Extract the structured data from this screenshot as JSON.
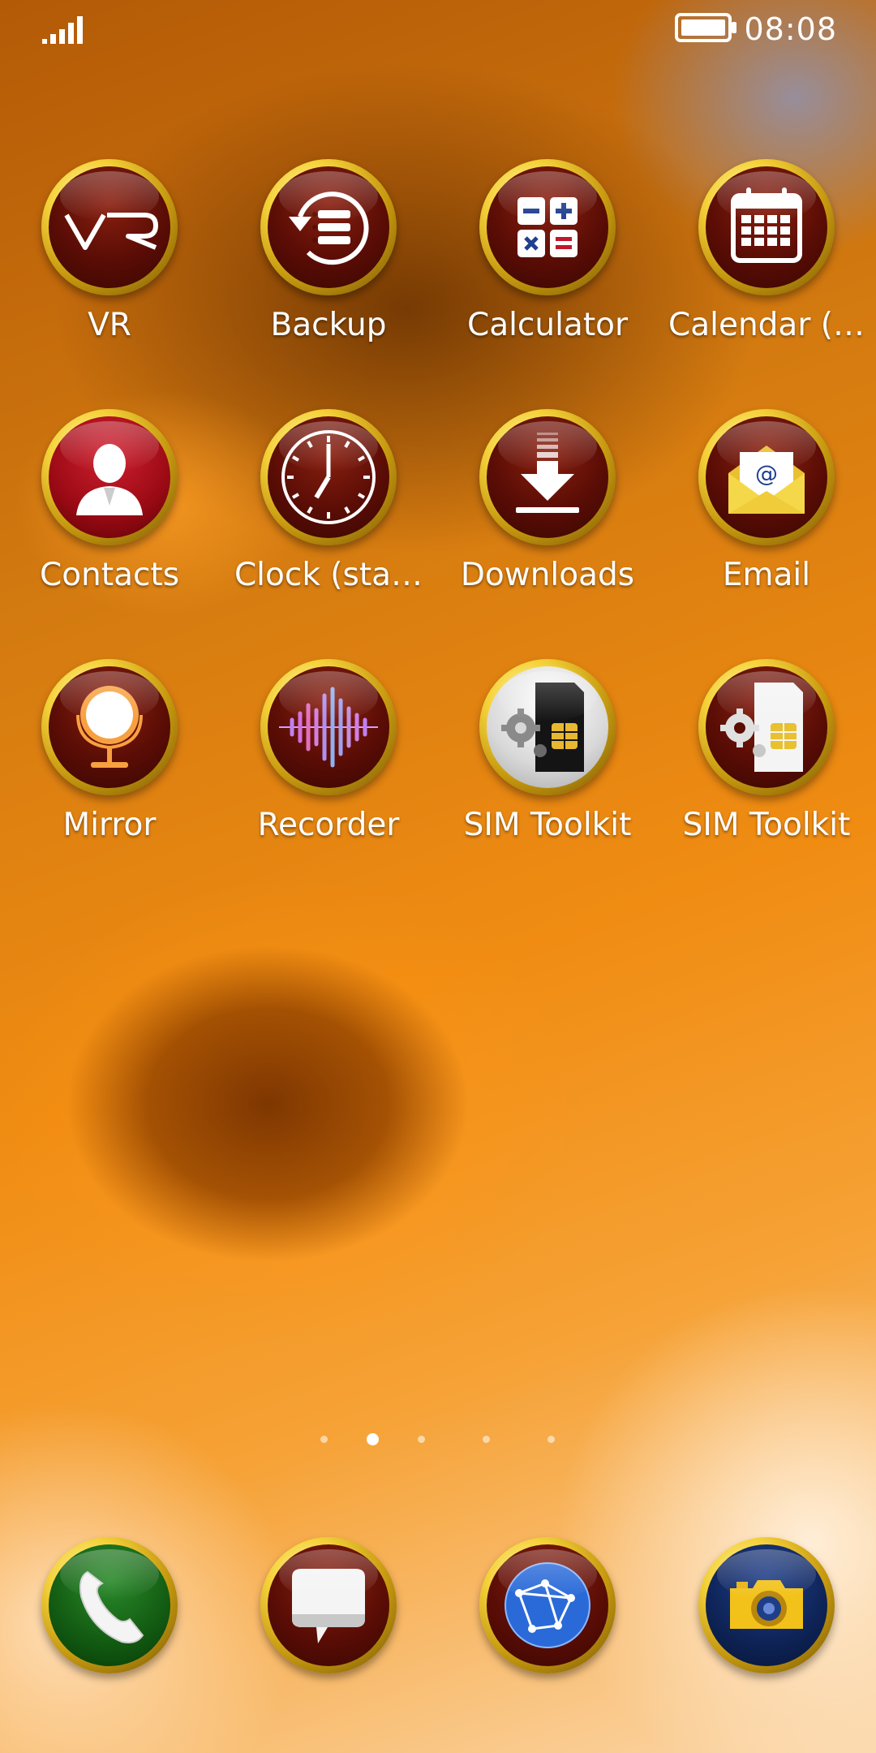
{
  "status": {
    "time": "08:08"
  },
  "apps": [
    {
      "label": "VR",
      "icon": "vr-icon"
    },
    {
      "label": "Backup",
      "icon": "backup-icon"
    },
    {
      "label": "Calculator",
      "icon": "calculator-icon"
    },
    {
      "label": "Calendar (…",
      "icon": "calendar-icon"
    },
    {
      "label": "Contacts",
      "icon": "contacts-icon"
    },
    {
      "label": "Clock (sta…",
      "icon": "clock-icon"
    },
    {
      "label": "Downloads",
      "icon": "downloads-icon"
    },
    {
      "label": "Email",
      "icon": "email-icon"
    },
    {
      "label": "Mirror",
      "icon": "mirror-icon"
    },
    {
      "label": "Recorder",
      "icon": "recorder-icon"
    },
    {
      "label": "SIM Toolkit",
      "icon": "sim-toolkit-icon"
    },
    {
      "label": "SIM Toolkit",
      "icon": "sim-toolkit-icon"
    }
  ],
  "dock": [
    {
      "icon": "phone-icon"
    },
    {
      "icon": "messages-icon"
    },
    {
      "icon": "browser-icon"
    },
    {
      "icon": "camera-icon"
    }
  ],
  "pages": {
    "count": 5,
    "current": 2
  },
  "colors": {
    "ring": "#f5d23a",
    "icon_bg": "#5a0d05",
    "wallpaper": "#f08c12"
  }
}
